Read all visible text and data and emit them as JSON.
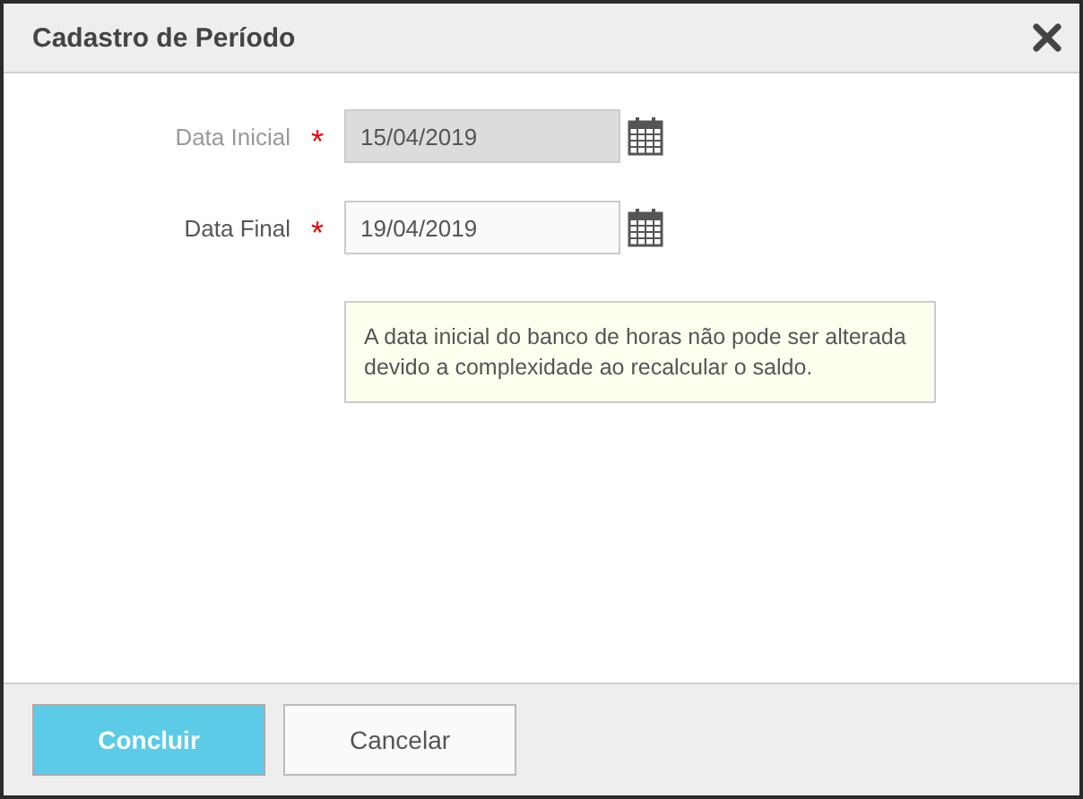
{
  "dialog": {
    "title": "Cadastro de Período"
  },
  "fields": [
    {
      "label": "Data Inicial",
      "required_mark": "*",
      "value": "15/04/2019",
      "disabled": true
    },
    {
      "label": "Data Final",
      "required_mark": "*",
      "value": "19/04/2019",
      "disabled": false
    }
  ],
  "note": "A data inicial do banco de horas não pode ser alterada devido a complexidade ao recalcular o saldo.",
  "buttons": [
    {
      "label": "Concluir",
      "kind": "primary"
    },
    {
      "label": "Cancelar",
      "kind": "secondary"
    }
  ]
}
